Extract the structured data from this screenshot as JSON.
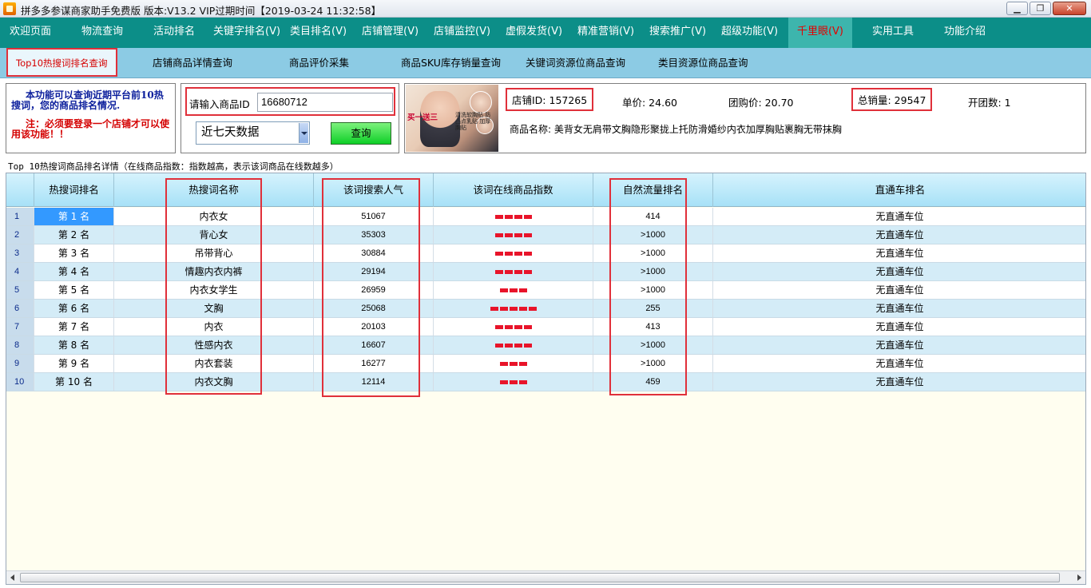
{
  "window": {
    "title": "拼多多参谋商家助手免费版 版本:V13.2 VIP过期时间【2019-03-24 11:32:58】",
    "minimize_glyph": "▁",
    "restore_glyph": "❐",
    "close_glyph": "✕"
  },
  "menu": {
    "items": [
      "欢迎页面",
      "物流查询",
      "活动排名",
      "关键字排名(V)",
      "类目排名(V)",
      "店铺管理(V)",
      "店铺监控(V)",
      "虚假发货(V)",
      "精准营销(V)",
      "搜索推广(V)",
      "超级功能(V)",
      "千里眼(V)",
      "实用工具",
      "功能介绍"
    ],
    "active": "千里眼(V)"
  },
  "submenu": {
    "items": [
      "Top10热搜词排名查询",
      "店铺商品详情查询",
      "商品评价采集",
      "商品SKU库存销量查询",
      "关键词资源位商品查询",
      "类目资源位商品查询"
    ],
    "active": "Top10热搜词排名查询"
  },
  "notice": {
    "line1": "本功能可以查询近期平台前10热搜词，您的商品排名情况.",
    "line2": "注：必须要登录一个店铺才可以使用该功能！！"
  },
  "search": {
    "id_label": "请输入商品ID",
    "id_value": "16680712",
    "range_value": "近七天数据",
    "query_button": "查询"
  },
  "product": {
    "thumb_badge": "买一送三",
    "thumb_text": "清洗软胸贴 防凸点乳贴 加厚胸贴",
    "shop_id": "店铺ID: 157265",
    "unit_price": "单价: 24.60",
    "group_price": "团购价: 20.70",
    "total_sales": "总销量: 29547",
    "group_count": "开团数: 1",
    "name": "商品名称: 美背女无肩带文胸隐形聚拢上托防滑婚纱内衣加厚胸贴裹胸无带抹胸"
  },
  "table": {
    "caption": "Top 10热搜词商品排名详情（在线商品指数：指数越高，表示该词商品在线数越多）",
    "headers": [
      "热搜词排名",
      "热搜词名称",
      "该词搜索人气",
      "该词在线商品指数",
      "自然流量排名",
      "直通车排名"
    ],
    "rows": [
      {
        "idx": "1",
        "rank": "第 1 名",
        "word": "内衣女",
        "popularity": "51067",
        "index_level": 4,
        "natural": "414",
        "zhitong": "无直通车位"
      },
      {
        "idx": "2",
        "rank": "第 2 名",
        "word": "背心女",
        "popularity": "35303",
        "index_level": 4,
        "natural": ">1000",
        "zhitong": "无直通车位"
      },
      {
        "idx": "3",
        "rank": "第 3 名",
        "word": "吊带背心",
        "popularity": "30884",
        "index_level": 4,
        "natural": ">1000",
        "zhitong": "无直通车位"
      },
      {
        "idx": "4",
        "rank": "第 4 名",
        "word": "情趣内衣内裤",
        "popularity": "29194",
        "index_level": 4,
        "natural": ">1000",
        "zhitong": "无直通车位"
      },
      {
        "idx": "5",
        "rank": "第 5 名",
        "word": "内衣女学生",
        "popularity": "26959",
        "index_level": 3,
        "natural": ">1000",
        "zhitong": "无直通车位"
      },
      {
        "idx": "6",
        "rank": "第 6 名",
        "word": "文胸",
        "popularity": "25068",
        "index_level": 5,
        "natural": "255",
        "zhitong": "无直通车位"
      },
      {
        "idx": "7",
        "rank": "第 7 名",
        "word": "内衣",
        "popularity": "20103",
        "index_level": 4,
        "natural": "413",
        "zhitong": "无直通车位"
      },
      {
        "idx": "8",
        "rank": "第 8 名",
        "word": "性感内衣",
        "popularity": "16607",
        "index_level": 4,
        "natural": ">1000",
        "zhitong": "无直通车位"
      },
      {
        "idx": "9",
        "rank": "第 9 名",
        "word": "内衣套装",
        "popularity": "16277",
        "index_level": 3,
        "natural": ">1000",
        "zhitong": "无直通车位"
      },
      {
        "idx": "10",
        "rank": "第 10 名",
        "word": "内衣文胸",
        "popularity": "12114",
        "index_level": 3,
        "natural": "459",
        "zhitong": "无直通车位"
      }
    ]
  },
  "colors": {
    "menu_bg": "#0c8e88",
    "submenu_bg": "#8ccbe4",
    "highlight": "#e0303a",
    "index_bar": "#e8142a"
  }
}
